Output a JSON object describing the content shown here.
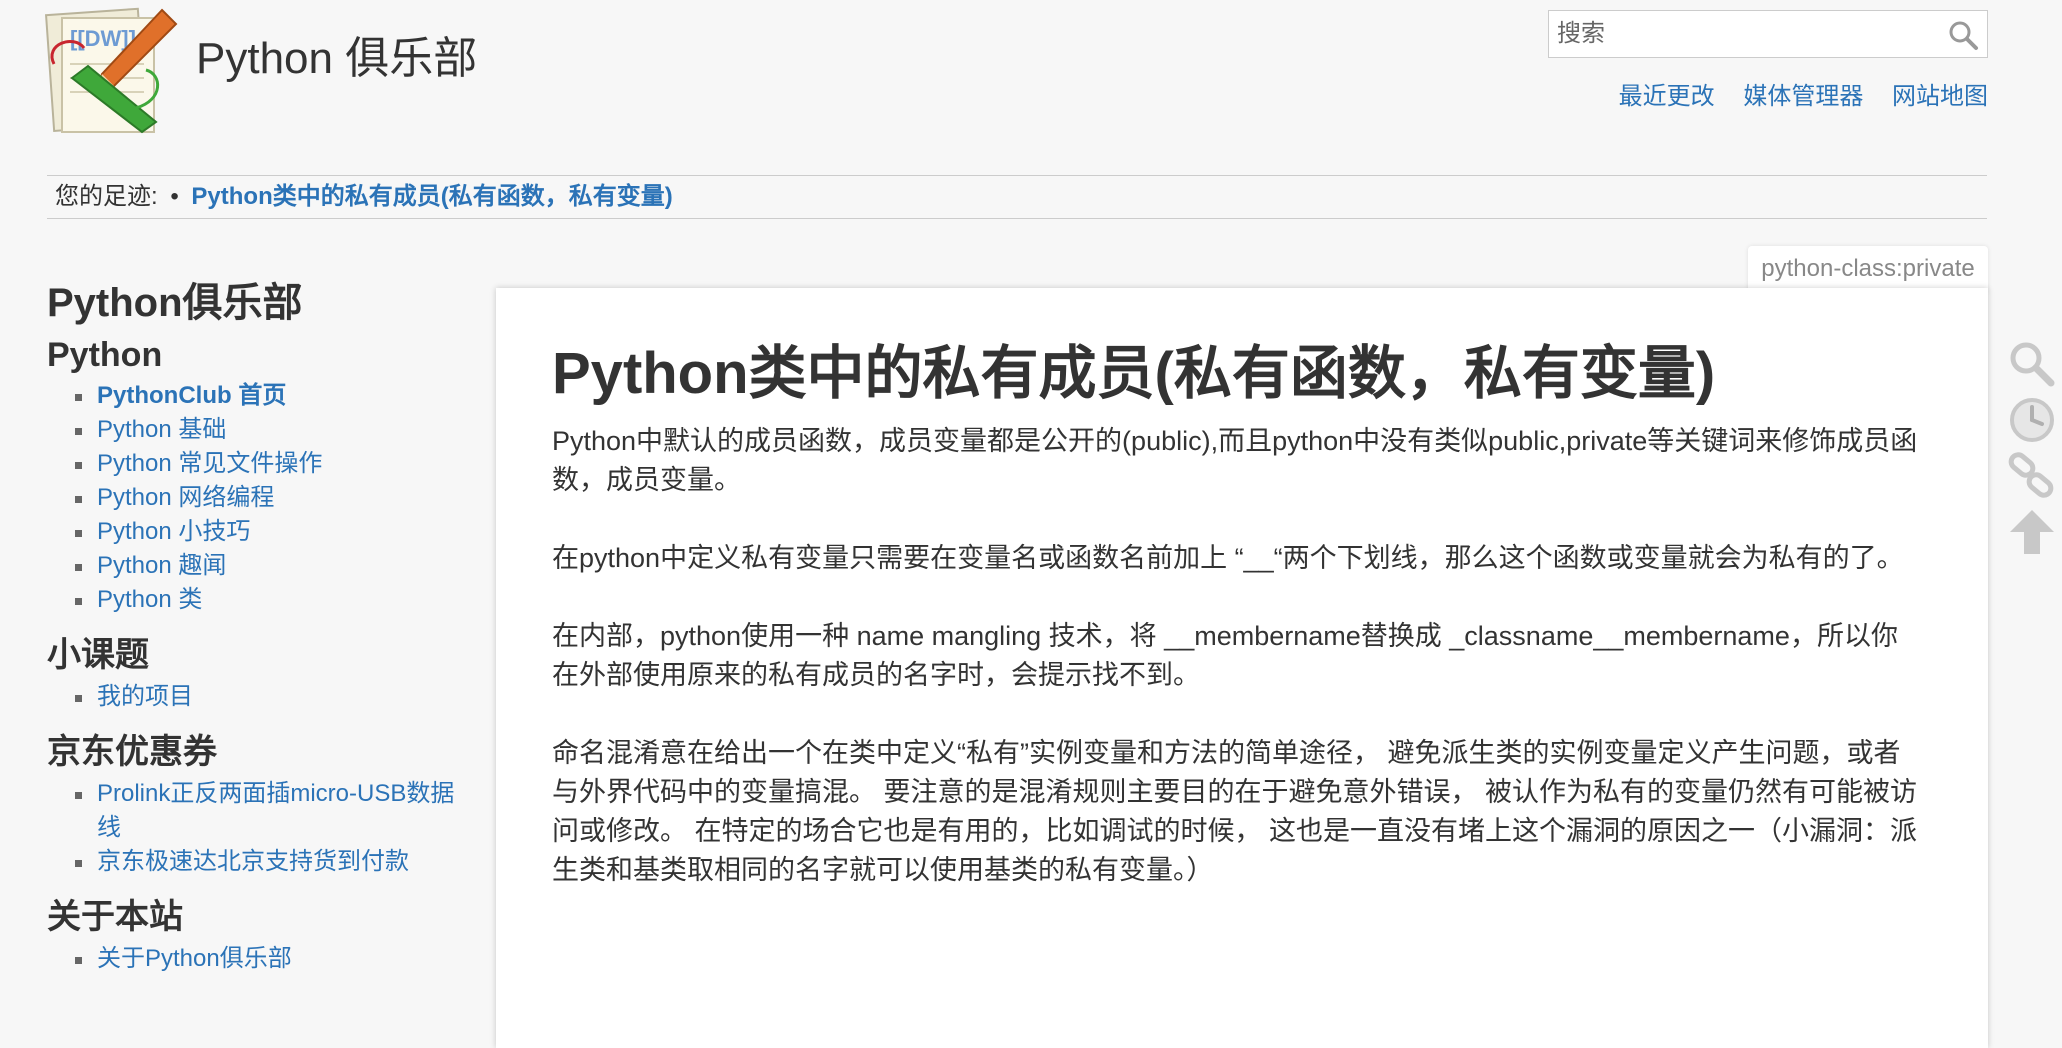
{
  "site": {
    "title": "Python 俱乐部",
    "logo_text": "[[DW]]",
    "logo_icon": "dokuwiki-logo-icon"
  },
  "search": {
    "placeholder": "搜索",
    "icon": "search-icon"
  },
  "top_links": [
    "最近更改",
    "媒体管理器",
    "网站地图"
  ],
  "breadcrumb": {
    "label": "您的足迹:",
    "separator": "•",
    "current": "Python类中的私有成员(私有函数，私有变量)"
  },
  "page_tag": "python-class:private",
  "sidebar": {
    "heading": "Python俱乐部",
    "sections": [
      {
        "title": "Python",
        "items": [
          "PythonClub 首页",
          "Python 基础",
          "Python 常见文件操作",
          "Python 网络编程",
          "Python 小技巧",
          "Python 趣闻",
          "Python 类"
        ]
      },
      {
        "title": "小课题",
        "items": [
          "我的项目"
        ]
      },
      {
        "title": "京东优惠券",
        "items": [
          "Prolink正反两面插micro-USB数据线",
          "京东极速达北京支持货到付款"
        ]
      },
      {
        "title": "关于本站",
        "items": [
          "关于Python俱乐部"
        ]
      }
    ]
  },
  "content": {
    "title": "Python类中的私有成员(私有函数，私有变量)",
    "paragraphs": [
      "Python中默认的成员函数，成员变量都是公开的(public),而且python中没有类似public,private等关键词来修饰成员函数，成员变量。",
      "在python中定义私有变量只需要在变量名或函数名前加上 “__“两个下划线，那么这个函数或变量就会为私有的了。",
      "在内部，python使用一种 name mangling 技术，将 __membername替换成 _classname__membername，所以你在外部使用原来的私有成员的名字时，会提示找不到。",
      "命名混淆意在给出一个在类中定义“私有”实例变量和方法的简单途径， 避免派生类的实例变量定义产生问题，或者与外界代码中的变量搞混。 要注意的是混淆规则主要目的在于避免意外错误， 被认作为私有的变量仍然有可能被访问或修改。 在特定的场合它也是有用的，比如调试的时候， 这也是一直没有堵上这个漏洞的原因之一（小漏洞：派生类和基类取相同的名字就可以使用基类的私有变量。）"
    ]
  },
  "page_tools": [
    "search-icon",
    "clock-icon",
    "link-icon",
    "arrow-up-icon"
  ]
}
